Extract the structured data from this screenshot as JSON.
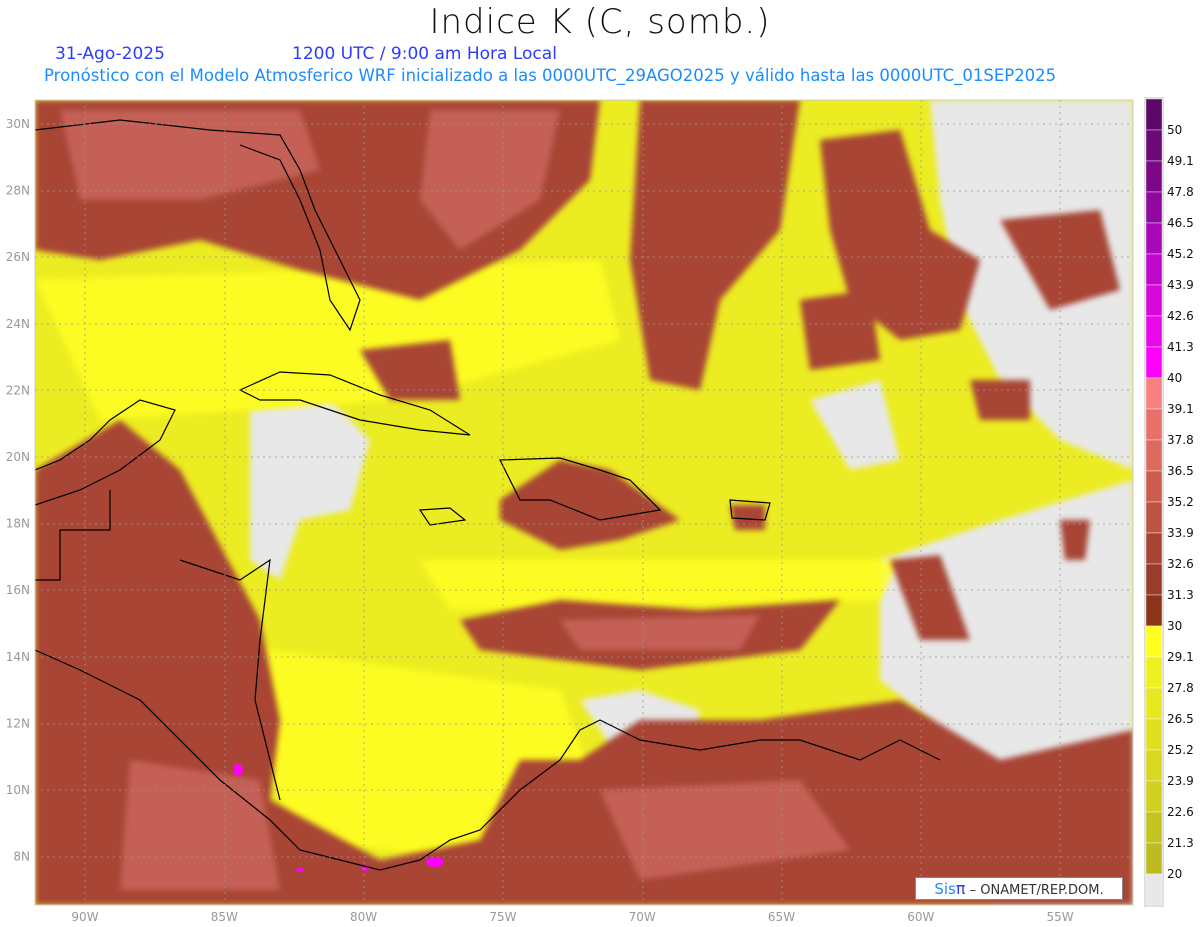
{
  "header": {
    "title": "Indice K (C, somb.)",
    "date": "31-Ago-2025",
    "time": "1200 UTC / 9:00 am Hora Local",
    "subtitle": "Pronóstico con el Modelo Atmosferico WRF inicializado a las 0000UTC_29AGO2025 y válido hasta las  0000UTC_01SEP2025"
  },
  "map": {
    "variable": "Indice K",
    "units": "C",
    "lon_range": [
      -92,
      -52.5
    ],
    "lat_range": [
      6.6,
      30.7
    ],
    "lon_labels": [
      "90W",
      "85W",
      "80W",
      "75W",
      "70W",
      "65W",
      "60W",
      "55W"
    ],
    "lat_labels": [
      "30N",
      "28N",
      "26N",
      "24N",
      "22N",
      "20N",
      "18N",
      "16N",
      "14N",
      "12N",
      "10N",
      "8N"
    ],
    "grid": true
  },
  "colorbar": {
    "labels": [
      "50",
      "49.1",
      "47.8",
      "46.5",
      "45.2",
      "43.9",
      "42.6",
      "41.3",
      "40",
      "39.1",
      "37.8",
      "36.5",
      "35.2",
      "33.9",
      "32.6",
      "31.3",
      "30",
      "29.1",
      "27.8",
      "26.5",
      "25.2",
      "23.9",
      "22.6",
      "21.3",
      "20"
    ],
    "colors": [
      "#5c0868",
      "#6c0878",
      "#7c0888",
      "#9008a0",
      "#a808b8",
      "#c008cc",
      "#d808dc",
      "#e808e8",
      "#ff00ff",
      "#f88080",
      "#e87068",
      "#dc6a5e",
      "#cc5c4c",
      "#bc5444",
      "#a84434",
      "#983c2c",
      "#8c3418",
      "#ffff20",
      "#f0f020",
      "#e8e820",
      "#e0e020",
      "#d8d820",
      "#d0d020",
      "#c4c420",
      "#bcbc20",
      "#e8e8e8"
    ]
  },
  "credit": {
    "logo_text": "Sis",
    "logo_symbol": "π",
    "text": "– ONAMET/REP.DOM."
  }
}
